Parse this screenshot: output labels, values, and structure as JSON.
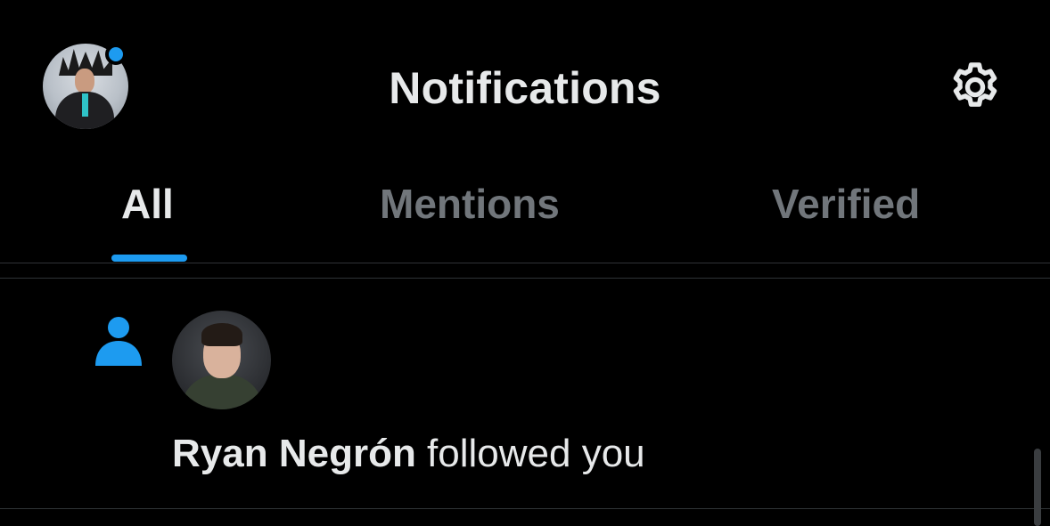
{
  "header": {
    "title": "Notifications",
    "avatar_icon": "user-avatar",
    "presence_color": "#1d9bf0",
    "settings_icon": "gear-icon"
  },
  "tabs": [
    {
      "label": "All",
      "active": true
    },
    {
      "label": "Mentions",
      "active": false
    },
    {
      "label": "Verified",
      "active": false
    }
  ],
  "notifications": [
    {
      "type_icon": "person-follow-icon",
      "user_name": "Ryan Negrón",
      "action_text": " followed you"
    }
  ],
  "colors": {
    "accent": "#1d9bf0",
    "background": "#000000",
    "text_primary": "#e7e9ea",
    "text_secondary": "#71767b",
    "divider": "#2f3336"
  }
}
